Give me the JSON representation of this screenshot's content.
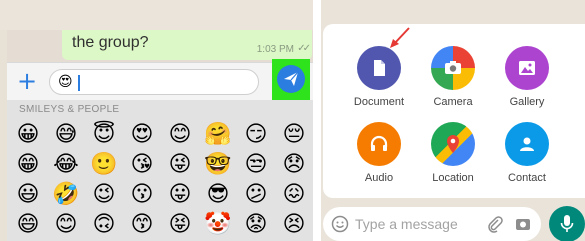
{
  "left_panel": {
    "chat": {
      "message_text": "the group?",
      "time": "1:03 PM",
      "ticks": "✓✓"
    },
    "input": {
      "plus_label": "+",
      "typed_emoji": "😍",
      "send_highlight_color": "#2ee31b"
    },
    "emoji_keyboard": {
      "section_title": "SMILEYS & PEOPLE",
      "rows": [
        [
          "😀",
          "😅",
          "😇",
          "😍",
          "😊",
          "🤗",
          "😏",
          "😔"
        ],
        [
          "😁",
          "😂",
          "🙂",
          "😘",
          "😜",
          "🤓",
          "😒",
          "😞"
        ],
        [
          "😃",
          "🤣",
          "😉",
          "😗",
          "😛",
          "😎",
          "😕",
          "😖"
        ],
        [
          "😄",
          "😊",
          "🙃",
          "😙",
          "😝",
          "🤡",
          "😟",
          "😣"
        ]
      ]
    }
  },
  "right_panel": {
    "attachments": [
      {
        "label": "Document",
        "icon": "document-icon",
        "color": "#5157ae"
      },
      {
        "label": "Camera",
        "icon": "camera-icon",
        "color": "#ea4335"
      },
      {
        "label": "Gallery",
        "icon": "gallery-icon",
        "color": "#ac44cf"
      },
      {
        "label": "Audio",
        "icon": "headphones-icon",
        "color": "#f57c00"
      },
      {
        "label": "Location",
        "icon": "location-icon",
        "color": "#1fa855"
      },
      {
        "label": "Contact",
        "icon": "contact-icon",
        "color": "#0b9ae8"
      }
    ],
    "compose": {
      "placeholder": "Type a message",
      "mic_color": "#00897b"
    }
  }
}
